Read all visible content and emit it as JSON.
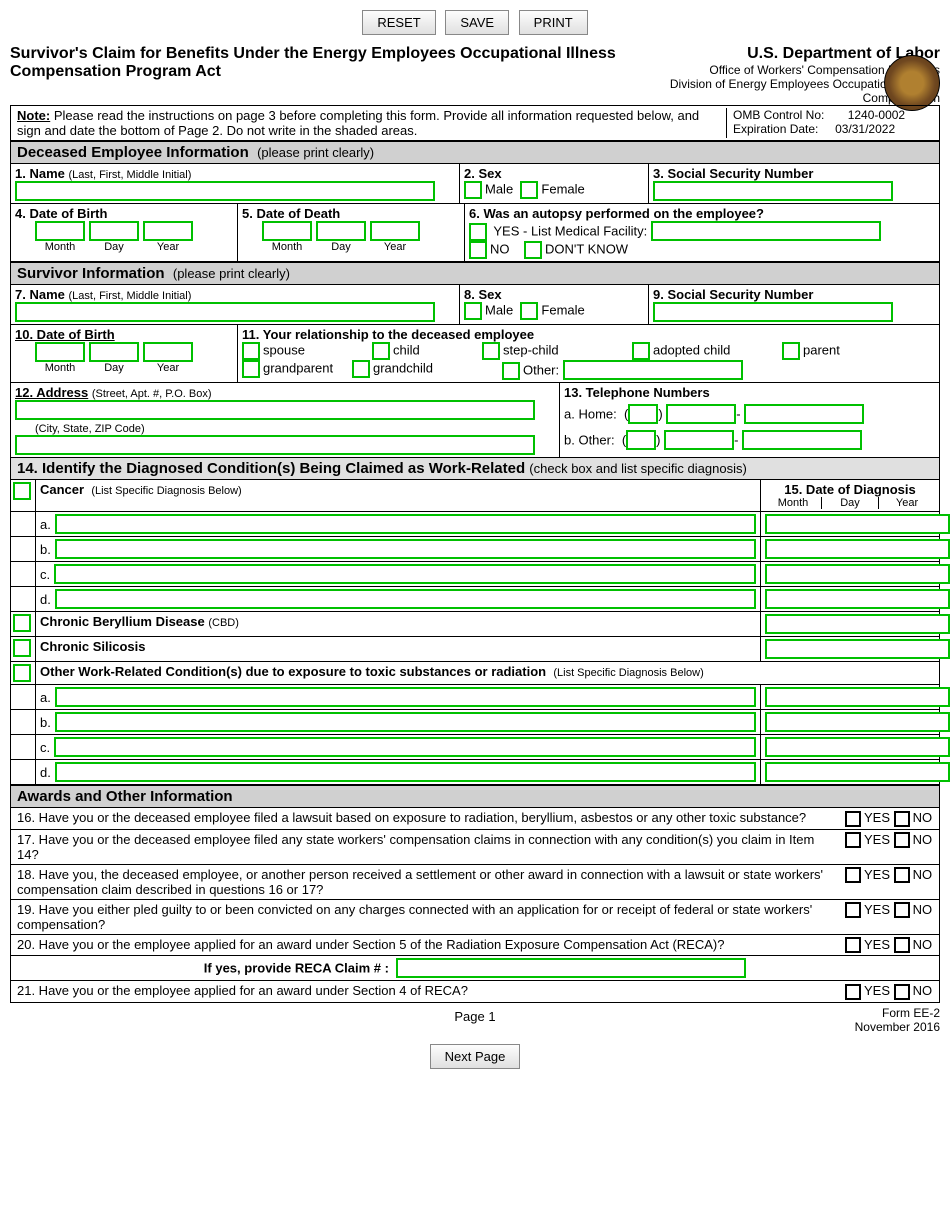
{
  "buttons": {
    "reset": "RESET",
    "save": "SAVE",
    "print": "PRINT",
    "next": "Next Page"
  },
  "title": "Survivor's Claim for Benefits Under the Energy Employees Occupational Illness Compensation Program Act",
  "dept": "U.S. Department of Labor",
  "dept_sub1": "Office of Workers' Compensation Programs",
  "dept_sub2": "Division of Energy Employees Occupational Illness Compensation",
  "note_label": "Note:",
  "note": "Please read the instructions on page 3 before completing this form.  Provide all information requested below, and sign and date the bottom of Page 2.  Do not write in the shaded areas.",
  "omb_label": "OMB Control No:",
  "omb": "1240-0002",
  "exp_label": "Expiration Date:",
  "exp": "03/31/2022",
  "sec_deceased": "Deceased Employee Information",
  "sec_survivor": "Survivor Information",
  "sec_awards": "Awards and Other Information",
  "hint_print": "(please print clearly)",
  "q1": "1.  Name",
  "q1_hint": "(Last, First, Middle Initial)",
  "q2": "2.  Sex",
  "male": "Male",
  "female": "Female",
  "q3": "3.  Social Security Number",
  "q4": "4.  Date of Birth",
  "q5": "5.  Date of Death",
  "q6": "6.  Was an autopsy performed on the employee?",
  "q6_yes": "YES - List Medical Facility:",
  "q6_no": "NO",
  "q6_dk": "DON'T KNOW",
  "q7": "7.  Name",
  "q8": "8.  Sex",
  "q9": "9.  Social Security Number",
  "q10": "10.  Date of Birth",
  "q11": "11.  Your relationship to the deceased employee",
  "rel": {
    "spouse": "spouse",
    "child": "child",
    "step": "step-child",
    "adopted": "adopted child",
    "parent": "parent",
    "gparent": "grandparent",
    "gchild": "grandchild",
    "other": "Other:"
  },
  "q12": "12.  Address",
  "q12_hint1": "(Street, Apt. #, P.O. Box)",
  "q12_hint2": "(City, State, ZIP Code)",
  "q13": "13.  Telephone Numbers",
  "q13a": "a.  Home:",
  "q13b": "b.  Other:",
  "q14": "14.  Identify the Diagnosed Condition(s) Being Claimed as Work-Related",
  "q14_hint": "(check box and list specific diagnosis)",
  "q15": "15.  Date of Diagnosis",
  "cond_cancer": "Cancer",
  "cond_cancer_hint": "(List Specific Diagnosis Below)",
  "cond_cbd": "Chronic Beryllium Disease",
  "cbd_paren": "(CBD)",
  "cond_sil": "Chronic Silicosis",
  "cond_other": "Other Work-Related Condition(s) due to exposure to toxic substances or radiation",
  "cond_other_hint": "(List Specific Diagnosis Below)",
  "labels": {
    "month": "Month",
    "day": "Day",
    "year": "Year",
    "a": "a.",
    "b": "b.",
    "c": "c.",
    "d": "d.",
    "open": "(",
    "close": ")"
  },
  "dash": "-",
  "q16": "16. Have you or the deceased employee filed a lawsuit based on exposure to radiation, beryllium, asbestos or any other toxic substance?",
  "q17": "17. Have you or the deceased employee filed any state workers' compensation claims in connection with any condition(s) you claim in Item 14?",
  "q18": "18. Have you, the deceased employee, or another person received a settlement or other award in connection with a lawsuit or state workers' compensation claim described in questions 16 or 17?",
  "q19": "19. Have you either pled guilty to or been convicted on any charges connected with an application for or receipt of federal or state workers' compensation?",
  "q20": "20. Have you or the employee applied for an award under Section 5 of the Radiation Exposure Compensation Act (RECA)?",
  "q20b": "If yes, provide RECA Claim # :",
  "q21": "21.  Have you or the employee applied for an award under Section 4 of RECA?",
  "yes": "YES",
  "no": "NO",
  "page": "Page 1",
  "form_no": "Form EE-2",
  "form_date": "November 2016"
}
